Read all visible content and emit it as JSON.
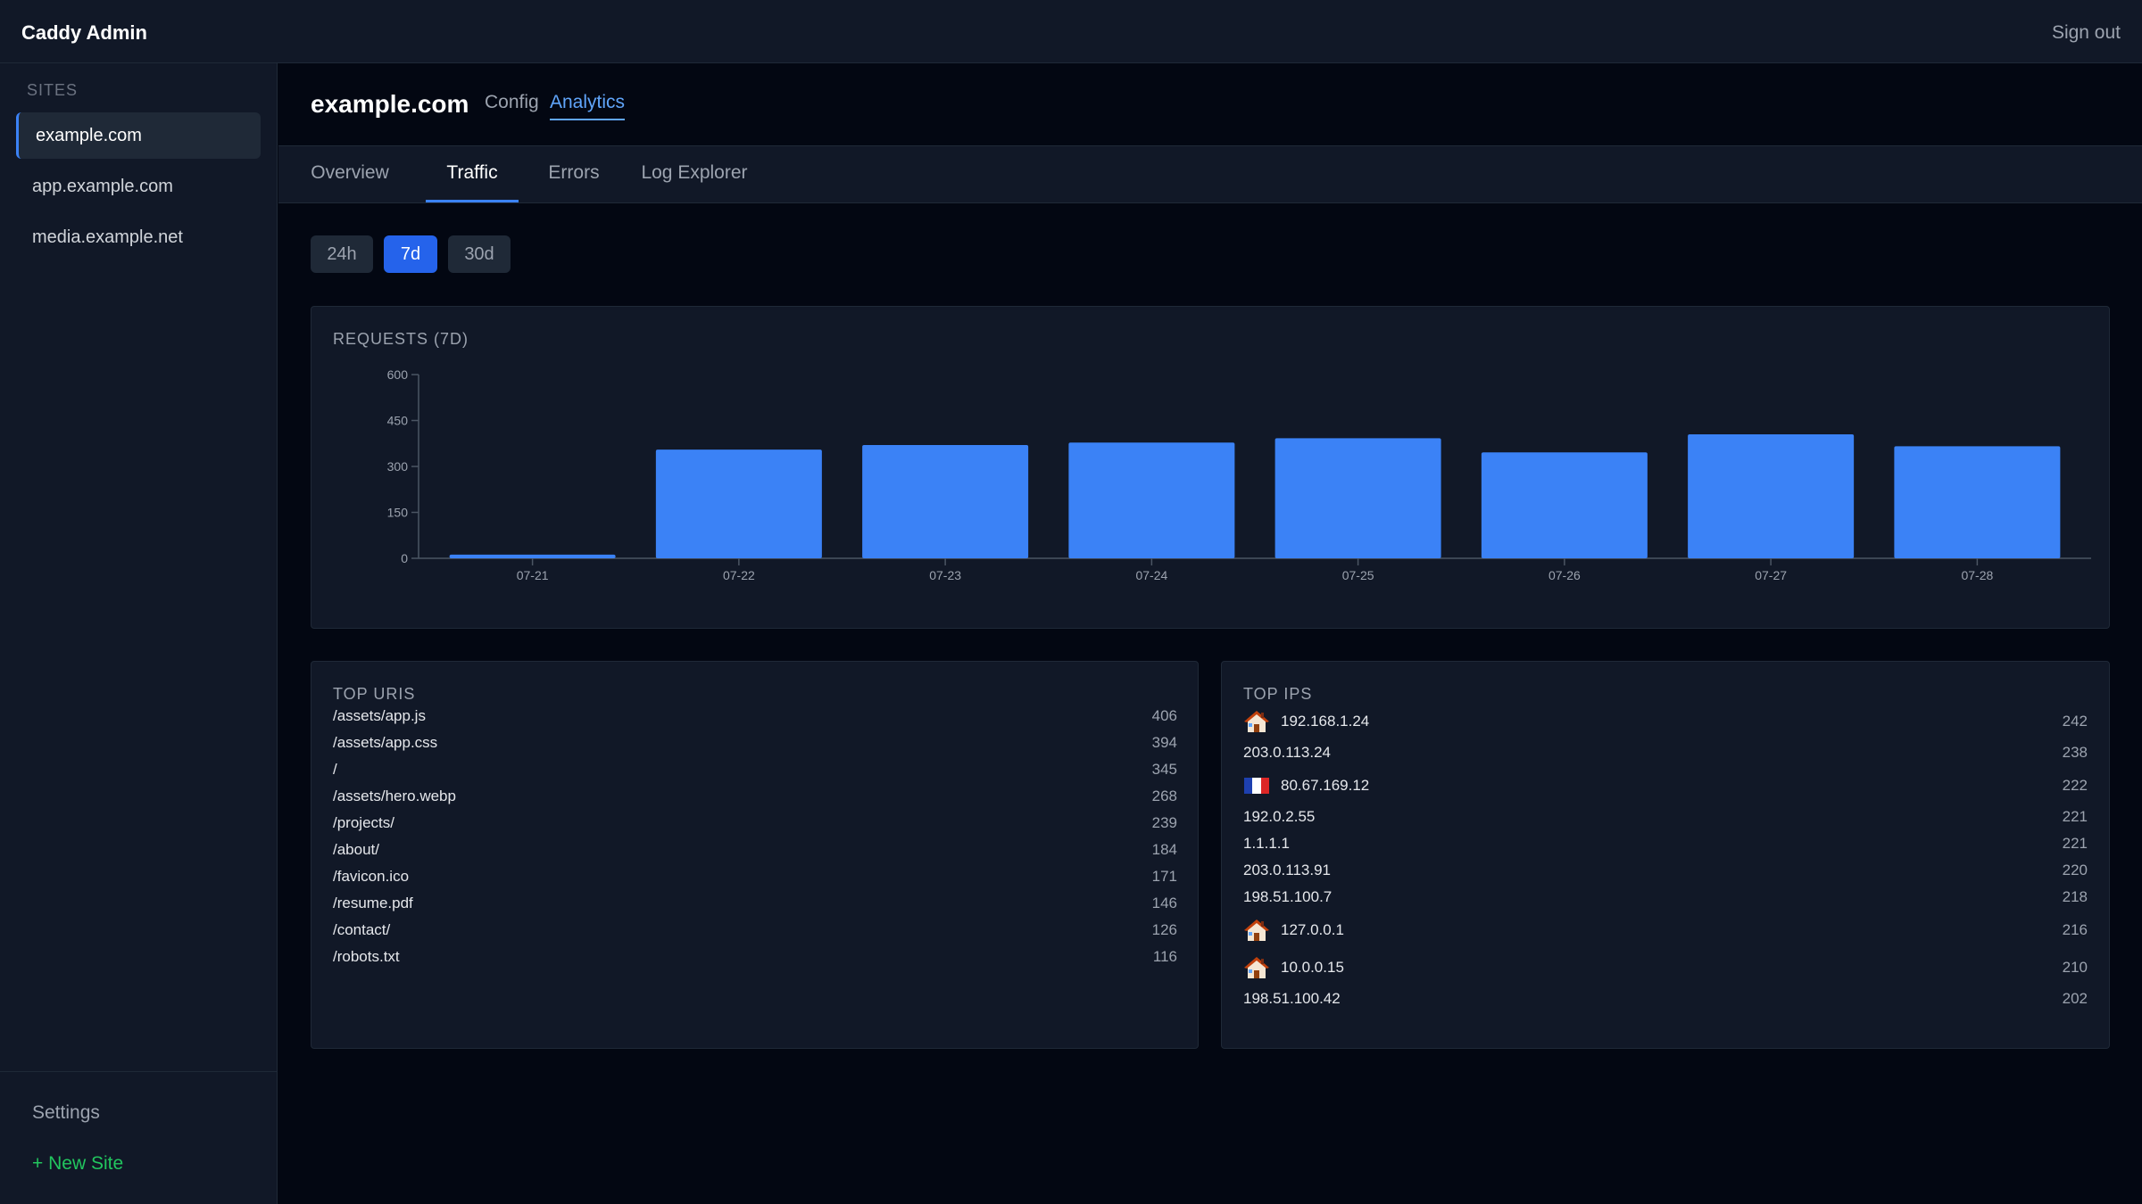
{
  "app": {
    "title": "Caddy Admin",
    "signout_label": "Sign out"
  },
  "sidebar": {
    "section_label": "SITES",
    "items": [
      {
        "label": "example.com",
        "active": true
      },
      {
        "label": "app.example.com",
        "active": false
      },
      {
        "label": "media.example.net",
        "active": false
      }
    ],
    "settings_label": "Settings",
    "new_site_label": "+ New Site"
  },
  "site": {
    "title": "example.com",
    "views": [
      {
        "label": "Config",
        "active": false
      },
      {
        "label": "Analytics",
        "active": true
      }
    ]
  },
  "subtabs": [
    {
      "label": "Overview",
      "active": false
    },
    {
      "label": "Traffic",
      "active": true
    },
    {
      "label": "Errors",
      "active": false
    },
    {
      "label": "Log Explorer",
      "active": false
    }
  ],
  "ranges": [
    {
      "label": "24h",
      "active": false
    },
    {
      "label": "7d",
      "active": true
    },
    {
      "label": "30d",
      "active": false
    }
  ],
  "chart_card": {
    "title": "REQUESTS (7D)"
  },
  "chart_data": {
    "type": "bar",
    "categories": [
      "07-21",
      "07-22",
      "07-23",
      "07-24",
      "07-25",
      "07-26",
      "07-27",
      "07-28"
    ],
    "values": [
      12,
      355,
      370,
      378,
      392,
      346,
      405,
      366
    ],
    "yticks": [
      0,
      150,
      300,
      450,
      600
    ],
    "ylim": [
      0,
      600
    ],
    "color": "#3b82f6",
    "grid": false
  },
  "top_uris": {
    "title": "TOP URIS",
    "rows": [
      {
        "label": "/assets/app.js",
        "count": "406"
      },
      {
        "label": "/assets/app.css",
        "count": "394"
      },
      {
        "label": "/",
        "count": "345"
      },
      {
        "label": "/assets/hero.webp",
        "count": "268"
      },
      {
        "label": "/projects/",
        "count": "239"
      },
      {
        "label": "/about/",
        "count": "184"
      },
      {
        "label": "/favicon.ico",
        "count": "171"
      },
      {
        "label": "/resume.pdf",
        "count": "146"
      },
      {
        "label": "/contact/",
        "count": "126"
      },
      {
        "label": "/robots.txt",
        "count": "116"
      }
    ]
  },
  "top_ips": {
    "title": "TOP IPS",
    "rows": [
      {
        "label": "192.168.1.24",
        "count": "242",
        "icon": "house-icon"
      },
      {
        "label": "203.0.113.24",
        "count": "238",
        "icon": ""
      },
      {
        "label": "80.67.169.12",
        "count": "222",
        "icon": "france-flag-icon"
      },
      {
        "label": "192.0.2.55",
        "count": "221",
        "icon": ""
      },
      {
        "label": "1.1.1.1",
        "count": "221",
        "icon": ""
      },
      {
        "label": "203.0.113.91",
        "count": "220",
        "icon": ""
      },
      {
        "label": "198.51.100.7",
        "count": "218",
        "icon": ""
      },
      {
        "label": "127.0.0.1",
        "count": "216",
        "icon": "house-icon"
      },
      {
        "label": "10.0.0.15",
        "count": "210",
        "icon": "house-icon"
      },
      {
        "label": "198.51.100.42",
        "count": "202",
        "icon": ""
      }
    ]
  }
}
